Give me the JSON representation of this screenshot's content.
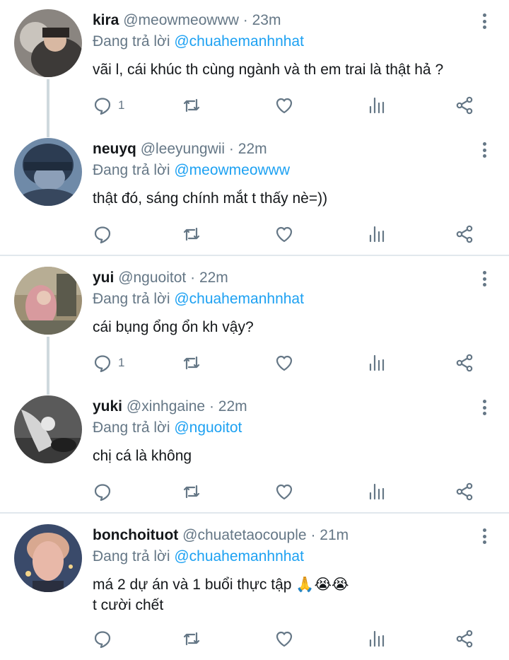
{
  "reply_prefix": "Đang trả lời",
  "tweets": [
    {
      "name": "kira",
      "handle": "@meowmeowww",
      "separator": "·",
      "time": "23m",
      "reply_to": "@chuahemanhnhat",
      "lines": [
        "vãi l, cái khúc th cùng ngành và th em trai là thật hả ?"
      ],
      "reply_count": "1",
      "avatar_colors": [
        "#8a8580",
        "#3d3a38"
      ]
    },
    {
      "name": "neuyq",
      "handle": "@leeyungwii",
      "separator": "·",
      "time": "22m",
      "reply_to": "@meowmeowww",
      "lines": [
        "thật đó, sáng chính mắt t thấy nè=))"
      ],
      "reply_count": "",
      "avatar_colors": [
        "#6f8aa8",
        "#2c3c52"
      ]
    },
    {
      "name": "yui",
      "handle": "@nguoitot",
      "separator": "·",
      "time": "22m",
      "reply_to": "@chuahemanhnhat",
      "lines": [
        "cái bụng ổng ổn kh vậy?"
      ],
      "reply_count": "1",
      "avatar_colors": [
        "#9c8f74",
        "#d89a9e"
      ]
    },
    {
      "name": "yuki",
      "handle": "@xinhgaine",
      "separator": "·",
      "time": "22m",
      "reply_to": "@nguoitot",
      "lines": [
        "chị cá là không"
      ],
      "reply_count": "",
      "avatar_colors": [
        "#5a5a5a",
        "#d4d4d4"
      ]
    },
    {
      "name": "bonchoituot",
      "handle": "@chuatetaocouple",
      "separator": "·",
      "time": "21m",
      "reply_to": "@chuahemanhnhat",
      "lines": [
        "má 2 dự án và 1 buổi thực tập",
        "t cười chết"
      ],
      "emoji": "🙏😭😭",
      "reply_count": "",
      "avatar_colors": [
        "#3a4a6a",
        "#e8b8a8"
      ]
    }
  ],
  "icons": [
    "reply-icon",
    "retweet-icon",
    "like-icon",
    "stats-icon",
    "share-icon",
    "more-options-icon"
  ],
  "colors": {
    "text": "#14171a",
    "secondary": "#657786",
    "mention": "#1da1f2",
    "divider": "#e1e8ed",
    "thread_line": "#cfd9de"
  }
}
